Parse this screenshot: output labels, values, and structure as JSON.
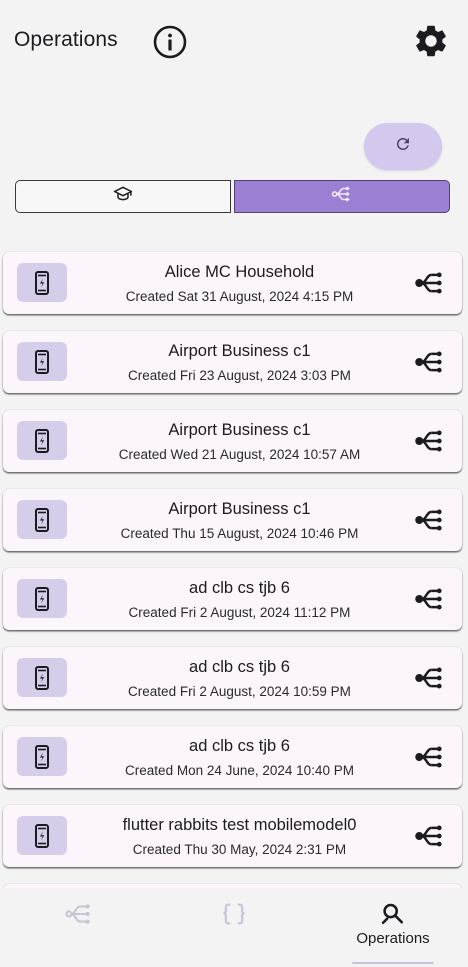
{
  "app_bar": {
    "title": "Operations",
    "info_icon": "info-circle-icon",
    "settings_icon": "gear-icon"
  },
  "refresh": {
    "icon": "refresh-icon"
  },
  "segments": [
    {
      "icon": "graduation-cap-icon",
      "selected": false
    },
    {
      "icon": "flow-branch-icon",
      "selected": true
    }
  ],
  "operations": [
    {
      "title": "Alice MC Household",
      "subtitle": "Created Sat 31 August, 2024 4:15 PM"
    },
    {
      "title": "Airport Business c1",
      "subtitle": "Created Fri 23 August, 2024 3:03 PM"
    },
    {
      "title": "Airport Business c1",
      "subtitle": "Created Wed 21 August, 2024 10:57 AM"
    },
    {
      "title": "Airport Business c1",
      "subtitle": "Created Thu 15 August, 2024 10:46 PM"
    },
    {
      "title": "ad clb cs tjb 6",
      "subtitle": "Created Fri 2 August, 2024 11:12 PM"
    },
    {
      "title": "ad clb cs tjb 6",
      "subtitle": "Created Fri 2 August, 2024 10:59 PM"
    },
    {
      "title": "ad clb cs tjb 6",
      "subtitle": "Created Mon 24 June, 2024 10:40 PM"
    },
    {
      "title": "flutter rabbits test mobilemodel0",
      "subtitle": "Created Thu 30 May, 2024 2:31 PM"
    }
  ],
  "bottom_nav": {
    "items": [
      {
        "icon": "flow-branch-icon",
        "label": ""
      },
      {
        "icon": "curly-braces-icon",
        "label": ""
      },
      {
        "icon": "search-icon",
        "label": "Operations",
        "selected": true
      }
    ]
  },
  "colors": {
    "accent": "#9a7fd3",
    "card_bg": "#fcf5fb",
    "icon_box_bg": "#d6cdea",
    "refresh_bg": "#d4c8ef"
  }
}
